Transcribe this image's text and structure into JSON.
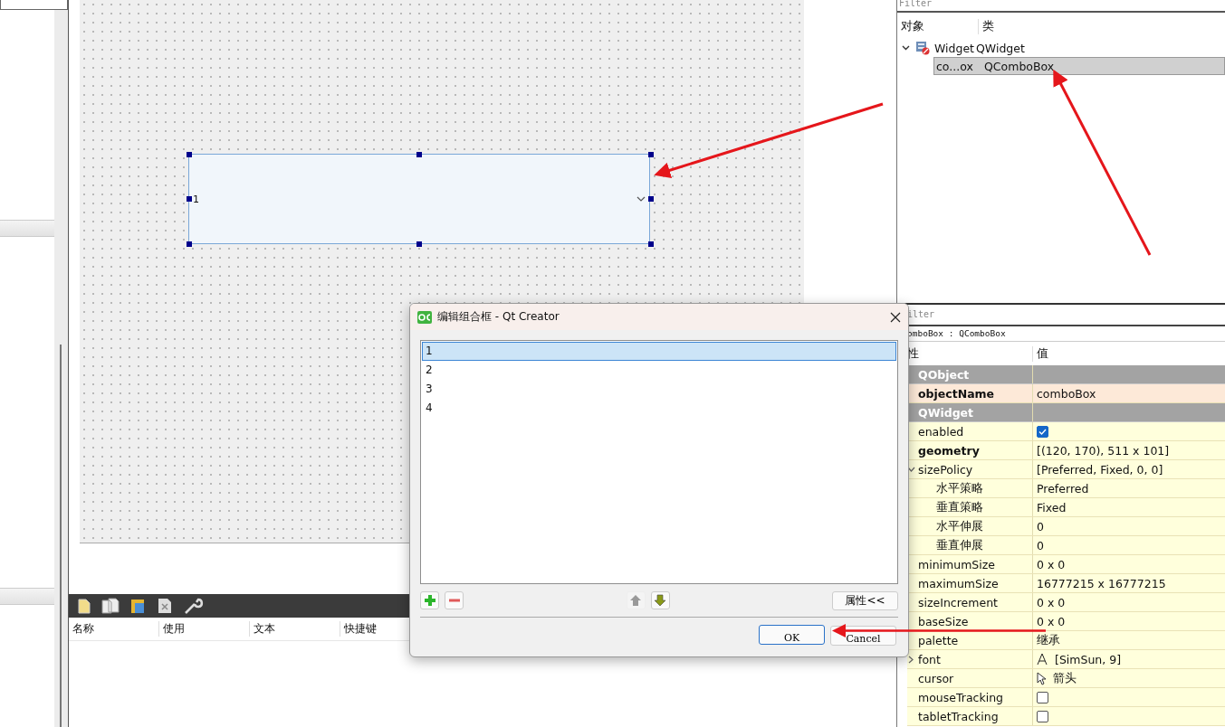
{
  "object_inspector": {
    "filter_placeholder": "Filter",
    "columns": [
      "对象",
      "类"
    ],
    "tree": [
      {
        "name": "Widget",
        "class": "QWidget",
        "expanded": true,
        "selected": false,
        "children": [
          {
            "name": "co...ox",
            "class": "QComboBox",
            "selected": true
          }
        ]
      }
    ]
  },
  "form": {
    "combobox_text": "1"
  },
  "action_editor": {
    "columns": [
      "名称",
      "使用",
      "文本",
      "快捷键"
    ]
  },
  "property_editor": {
    "filter_placeholder": "ilter",
    "object_label": "omboBox : QComboBox",
    "columns": [
      "性",
      "值"
    ],
    "rows": [
      {
        "kind": "group",
        "name": "QObject"
      },
      {
        "kind": "text",
        "name": "objectName",
        "value": "comboBox",
        "bold": true,
        "highlighted": true
      },
      {
        "kind": "group",
        "name": "QWidget"
      },
      {
        "kind": "checkbox",
        "name": "enabled",
        "checked": true,
        "bold": false,
        "highlighted": false
      },
      {
        "kind": "text",
        "name": "geometry",
        "value": "[(120, 170), 511 x 101]",
        "bold": true,
        "highlighted": false
      },
      {
        "kind": "text",
        "name": "sizePolicy",
        "value": "[Preferred, Fixed, 0, 0]",
        "bold": false,
        "highlighted": false,
        "expanded": true,
        "children": [
          {
            "kind": "text",
            "name": "水平策略",
            "value": "Preferred",
            "bold": false,
            "highlighted": false
          },
          {
            "kind": "text",
            "name": "垂直策略",
            "value": "Fixed",
            "bold": false,
            "highlighted": false
          },
          {
            "kind": "text",
            "name": "水平伸展",
            "value": "0",
            "bold": false,
            "highlighted": false
          },
          {
            "kind": "text",
            "name": "垂直伸展",
            "value": "0",
            "bold": false,
            "highlighted": false
          }
        ]
      },
      {
        "kind": "text",
        "name": "minimumSize",
        "value": "0 x 0",
        "bold": false,
        "highlighted": false
      },
      {
        "kind": "text",
        "name": "maximumSize",
        "value": "16777215 x 16777215",
        "bold": false,
        "highlighted": false
      },
      {
        "kind": "text",
        "name": "sizeIncrement",
        "value": "0 x 0",
        "bold": false,
        "highlighted": false
      },
      {
        "kind": "text",
        "name": "baseSize",
        "value": "0 x 0",
        "bold": false,
        "highlighted": false
      },
      {
        "kind": "text",
        "name": "palette",
        "value": "继承",
        "bold": false,
        "highlighted": false
      },
      {
        "kind": "font",
        "name": "font",
        "value": "[SimSun, 9]",
        "bold": false,
        "highlighted": false,
        "expanded": false
      },
      {
        "kind": "cursor",
        "name": "cursor",
        "value": "箭头",
        "bold": false,
        "highlighted": false
      },
      {
        "kind": "checkbox",
        "name": "mouseTracking",
        "checked": false,
        "bold": false,
        "highlighted": false
      },
      {
        "kind": "checkbox",
        "name": "tabletTracking",
        "checked": false,
        "bold": false,
        "highlighted": false
      }
    ]
  },
  "dialog": {
    "title": "编辑组合框 - Qt Creator",
    "items": [
      {
        "text": "1",
        "selected": true
      },
      {
        "text": "2",
        "selected": false
      },
      {
        "text": "3",
        "selected": false
      },
      {
        "text": "4",
        "selected": false
      }
    ],
    "properties_button": "属性<<",
    "ok_button": "OK",
    "cancel_button": "Cancel"
  }
}
